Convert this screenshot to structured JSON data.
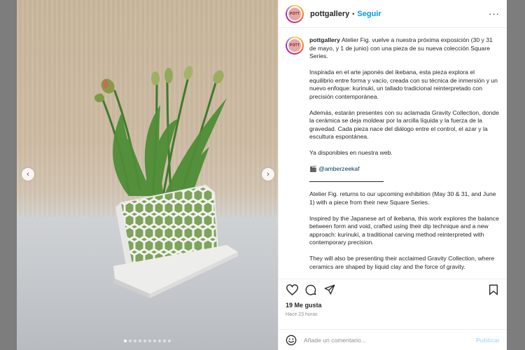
{
  "header": {
    "avatar_text": "POTT",
    "username": "pottgallery",
    "separator": "•",
    "follow_label": "Seguir",
    "more_label": "···"
  },
  "media": {
    "prev_arrow": "‹",
    "next_arrow": "›",
    "carousel": {
      "count": 10,
      "active_index": 0
    },
    "scene_icon": "ceramic-lattice-vase-with-tulips-photo"
  },
  "caption": {
    "avatar_text": "POTT",
    "username": "pottgallery",
    "p1": "Atelier Fig. vuelve a nuestra próxima exposición (30 y 31 de mayo, y 1 de junio) con una pieza de su nueva colección Square Series.",
    "p2": "Inspirada en el arte japonés del ikebana, esta pieza explora el equilibrio entre forma y vacío, creada con su técnica de inmersión y un nuevo enfoque: kurinuki, un tallado tradicional reinterpretado con precisión contemporánea.",
    "p3": "Además, estarán presentes con su aclamada Gravity Collection, donde la cerámica se deja moldear por la arcilla líquida y la fuerza de la gravedad. Cada pieza nace del diálogo entre el control, el azar y la escultura espontánea.",
    "p4": "Ya disponibles en nuestra web.",
    "camera_emoji": "🎬",
    "mention": "@amberzeekaf",
    "p5": "Atelier Fig. returns to our upcoming exhibition (May 30 & 31, and June 1) with a piece from their new Square Series.",
    "p6": "Inspired by the Japanese art of ikebana, this work explores the balance between form and void, crafted using their dip technique and a new approach: kurinuki, a traditional carving method reinterpreted with contemporary precision.",
    "p7": "They will also be presenting their acclaimed Gravity Collection, where ceramics are shaped by liquid clay and the force of gravity."
  },
  "actions": {
    "icons": [
      "heart-icon",
      "comment-icon",
      "share-icon",
      "bookmark-icon"
    ]
  },
  "likes_text": "19 Me gusta",
  "time_text": "Hace 23 horas",
  "comment": {
    "placeholder": "Añade un comentario...",
    "publish_label": "Publicar"
  },
  "colors": {
    "accent": "#0095f6",
    "publish_disabled": "#b3dbff",
    "mention": "#00376b",
    "backdrop": "#7d7d7d"
  }
}
